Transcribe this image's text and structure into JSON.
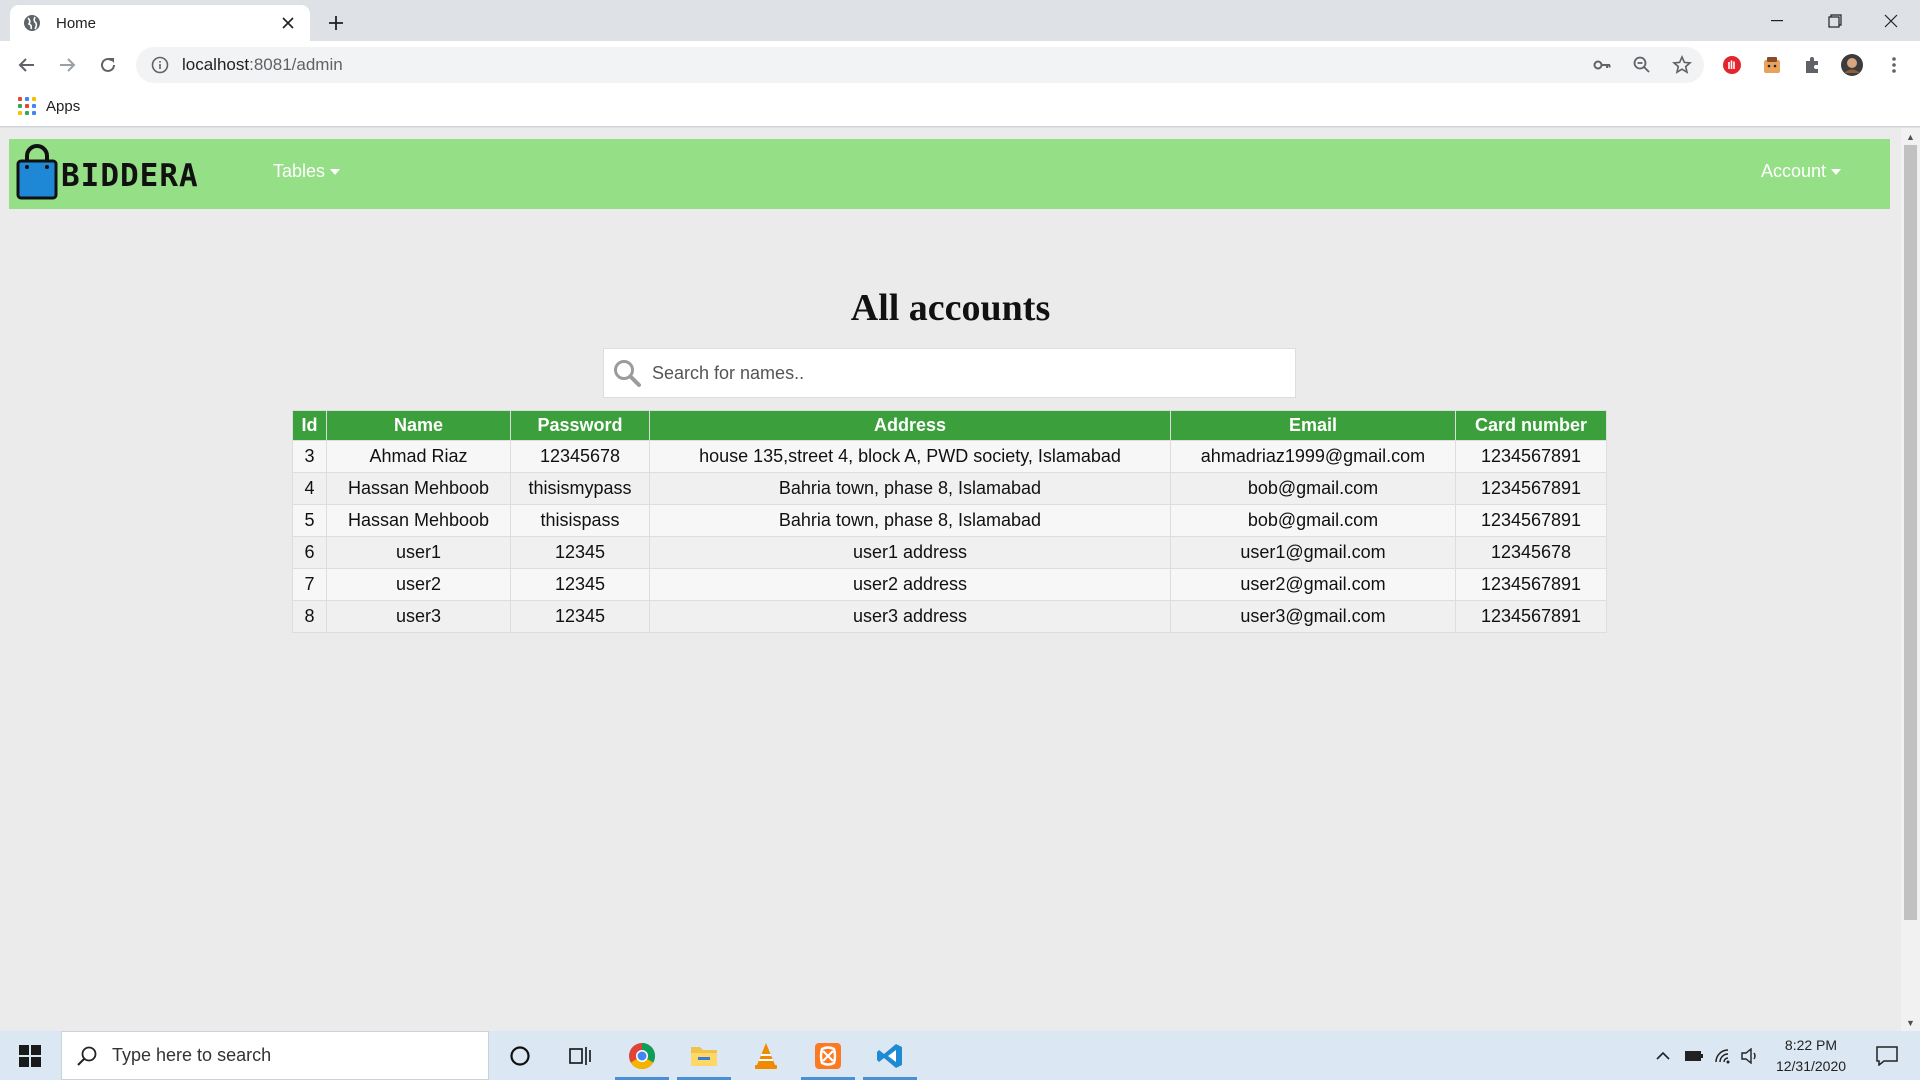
{
  "browser": {
    "tab_title": "Home",
    "url_host": "localhost",
    "url_port": ":8081",
    "url_path": "/admin",
    "bookmarks_apps_label": "Apps"
  },
  "navbar": {
    "brand": "BIDDERA",
    "tables_label": "Tables",
    "account_label": "Account"
  },
  "page": {
    "title": "All accounts",
    "search_placeholder": "Search for names.."
  },
  "table": {
    "headers": [
      "Id",
      "Name",
      "Password",
      "Address",
      "Email",
      "Card number"
    ],
    "rows": [
      [
        "3",
        "Ahmad Riaz",
        "12345678",
        "house 135,street 4, block A, PWD society, Islamabad",
        "ahmadriaz1999@gmail.com",
        "1234567891"
      ],
      [
        "4",
        "Hassan Mehboob",
        "thisismypass",
        "Bahria town, phase 8, Islamabad",
        "bob@gmail.com",
        "1234567891"
      ],
      [
        "5",
        "Hassan Mehboob",
        "thisispass",
        "Bahria town, phase 8, Islamabad",
        "bob@gmail.com",
        "1234567891"
      ],
      [
        "6",
        "user1",
        "12345",
        "user1 address",
        "user1@gmail.com",
        "12345678"
      ],
      [
        "7",
        "user2",
        "12345",
        "user2 address",
        "user2@gmail.com",
        "1234567891"
      ],
      [
        "8",
        "user3",
        "12345",
        "user3 address",
        "user3@gmail.com",
        "1234567891"
      ]
    ]
  },
  "taskbar": {
    "search_placeholder": "Type here to search",
    "time": "8:22 PM",
    "date": "12/31/2020"
  },
  "colors": {
    "navbar_bg": "#95df87",
    "table_header_bg": "#3b9f3b",
    "page_bg": "#ebebeb"
  },
  "icons": [
    "globe-icon",
    "close-icon",
    "plus-icon",
    "minimize-icon",
    "restore-icon",
    "back-arrow-icon",
    "forward-arrow-icon",
    "reload-icon",
    "info-icon",
    "key-icon",
    "zoom-icon",
    "star-icon",
    "extensions-icon",
    "profile-icon",
    "menu-dots-icon",
    "apps-grid-icon",
    "shopping-bag-icon",
    "search-icon",
    "windows-start-icon",
    "cortana-icon",
    "task-view-icon",
    "chrome-icon",
    "file-explorer-icon",
    "vlc-icon",
    "xampp-icon",
    "vscode-icon",
    "notification-icon"
  ]
}
